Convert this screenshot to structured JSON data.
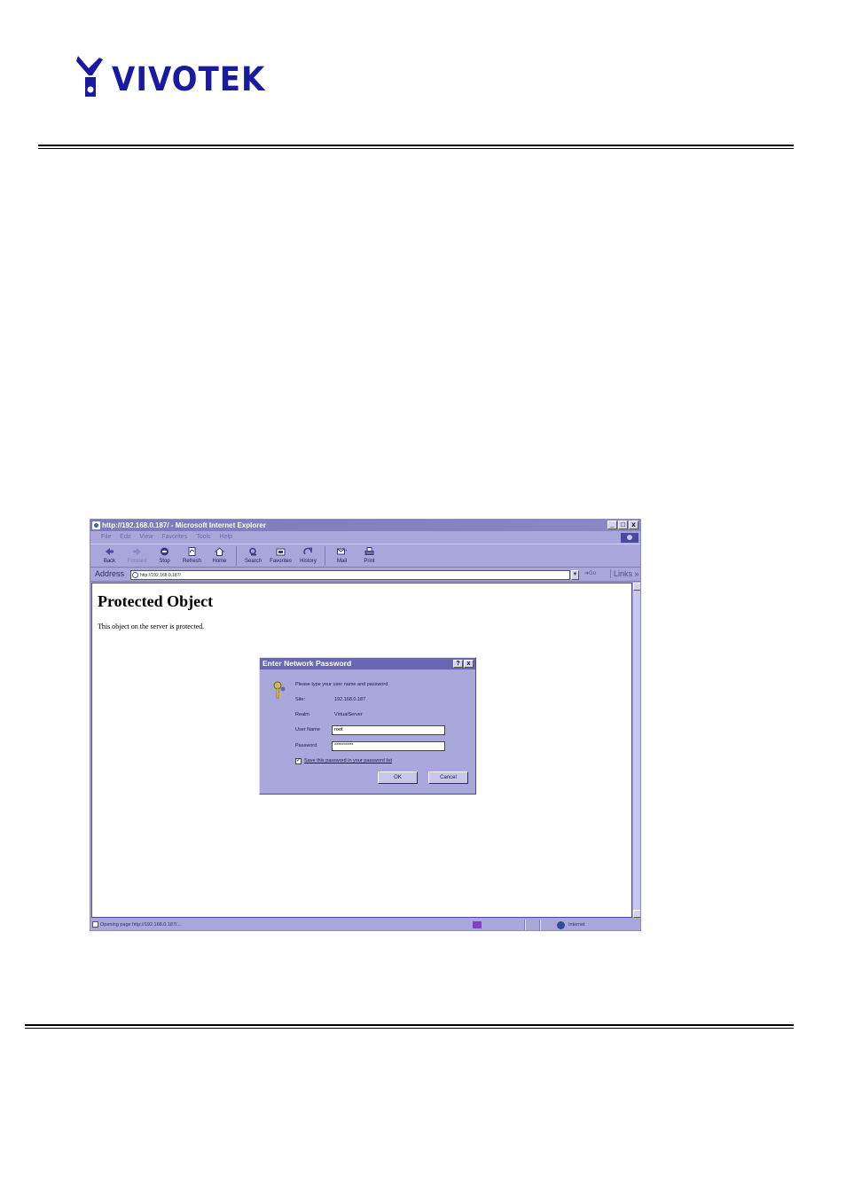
{
  "header": {
    "brand": "VIVOTEK"
  },
  "browser": {
    "title": "http://192.168.0.187/ - Microsoft Internet Explorer",
    "window_buttons": [
      "_",
      "□",
      "x"
    ],
    "menu": [
      "File",
      "Edit",
      "View",
      "Favorites",
      "Tools",
      "Help"
    ],
    "toolbar": [
      {
        "name": "back",
        "label": "Back",
        "icon": "back-arrow-icon",
        "enabled": true
      },
      {
        "name": "forward",
        "label": "Forward",
        "icon": "forward-arrow-icon",
        "enabled": false
      },
      {
        "name": "stop",
        "label": "Stop",
        "icon": "stop-icon",
        "enabled": true
      },
      {
        "name": "refresh",
        "label": "Refresh",
        "icon": "refresh-icon",
        "enabled": true
      },
      {
        "name": "home",
        "label": "Home",
        "icon": "home-icon",
        "enabled": true
      },
      {
        "name": "search",
        "label": "Search",
        "icon": "search-icon",
        "enabled": true
      },
      {
        "name": "favorites",
        "label": "Favorites",
        "icon": "favorites-icon",
        "enabled": true
      },
      {
        "name": "history",
        "label": "History",
        "icon": "history-icon",
        "enabled": true
      },
      {
        "name": "mail",
        "label": "Mail",
        "icon": "mail-icon",
        "enabled": true
      },
      {
        "name": "print",
        "label": "Print",
        "icon": "print-icon",
        "enabled": true
      }
    ],
    "address_label": "Address",
    "address_value": "http://192.168.0.187/",
    "go_label": "Go",
    "links_label": "Links",
    "content": {
      "heading": "Protected Object",
      "text": "This object on the server is protected."
    },
    "status": {
      "text": "Opening page http://192.168.0.187/...",
      "zone": "Internet"
    }
  },
  "dialog": {
    "title": "Enter Network Password",
    "title_buttons": [
      "?",
      "x"
    ],
    "prompt": "Please type your user name and password.",
    "site_label": "Site:",
    "site_value": "192.168.0.187",
    "realm_label": "Realm",
    "realm_value": "VirtualServer",
    "username_label": "User Name",
    "username_value": "root",
    "password_label": "Password",
    "password_value": "**********",
    "save_password_label": "Save this password in your password list",
    "save_password_checked": true,
    "ok_label": "OK",
    "cancel_label": "Cancel"
  },
  "colors": {
    "brand": "#1a1aa0",
    "window_chrome": "#a9a6dc",
    "dialog_title": "#6a67b2"
  }
}
